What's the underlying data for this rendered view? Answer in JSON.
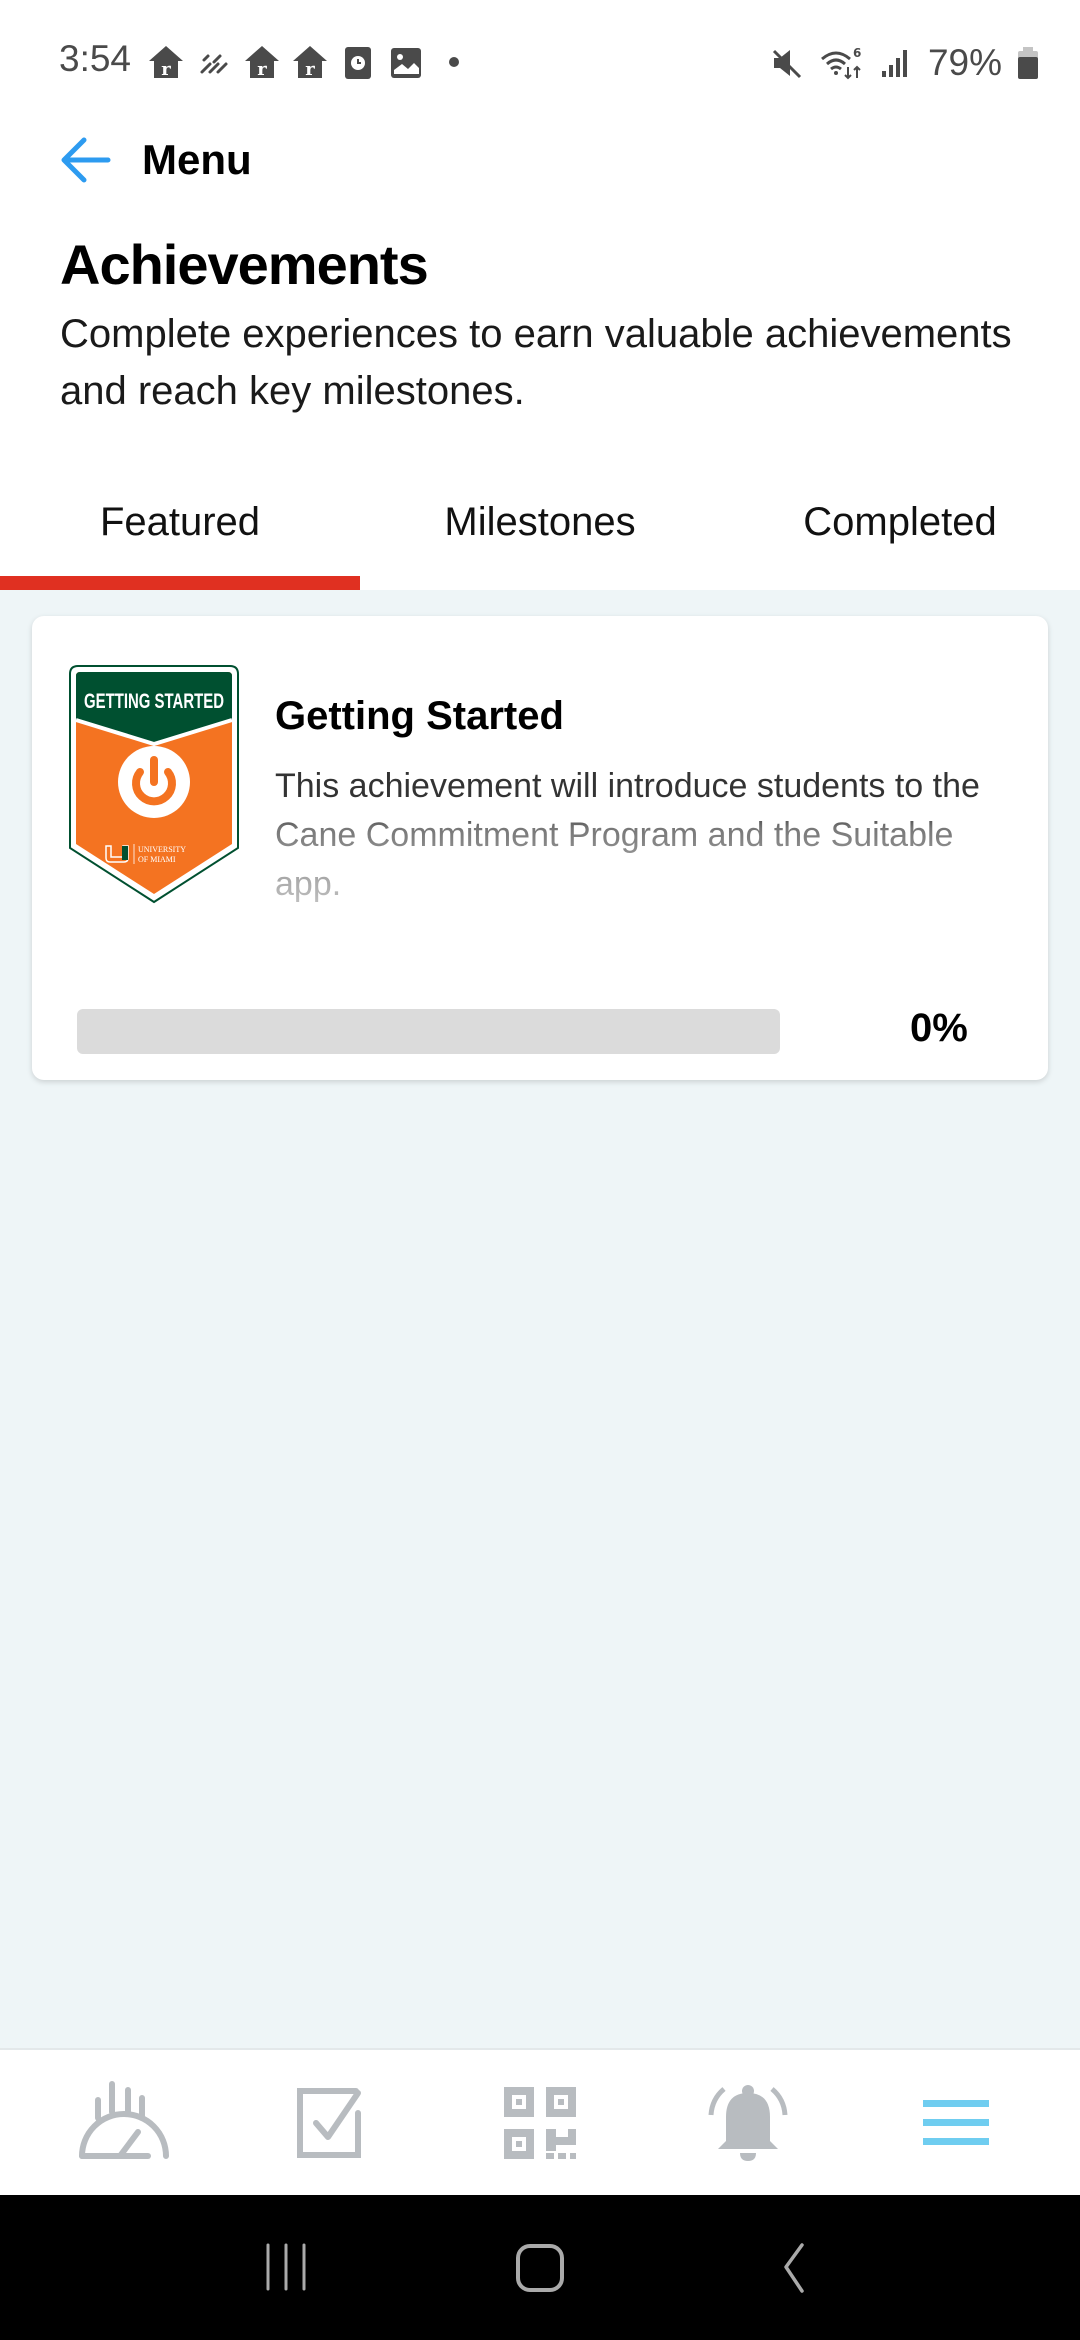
{
  "status_bar": {
    "time": "3:54",
    "battery_percent": "79%",
    "left_icons": [
      "realtor-app-icon",
      "sunlight-icon",
      "realtor-app-icon",
      "realtor-app-icon",
      "clock-app-icon",
      "gallery-icon",
      "dot-icon"
    ],
    "right_icons": [
      "mute-icon",
      "wifi-6-icon",
      "signal-icon",
      "battery-icon"
    ]
  },
  "header": {
    "back_label": "Menu"
  },
  "page": {
    "title": "Achievements",
    "subtitle": "Complete experiences to earn valuable achievements and reach key milestones."
  },
  "tabs": [
    {
      "label": "Featured",
      "active": true
    },
    {
      "label": "Milestones",
      "active": false
    },
    {
      "label": "Completed",
      "active": false
    }
  ],
  "achievements": [
    {
      "title": "Getting Started",
      "description": "This achievement will introduce students to the Cane Commitment Program and the Suitable app.",
      "badge": {
        "banner_text": "GETTING STARTED",
        "org_line1": "UNIVERSITY",
        "org_line2": "OF MIAMI",
        "icon": "power-icon"
      },
      "progress": 0,
      "progress_label": "0%"
    }
  ],
  "bottom_nav": [
    {
      "name": "dashboard",
      "icon": "gauge-icon",
      "active": false
    },
    {
      "name": "tasks",
      "icon": "checkbox-icon",
      "active": false
    },
    {
      "name": "scan",
      "icon": "qr-code-icon",
      "active": false
    },
    {
      "name": "notifications",
      "icon": "bell-icon",
      "active": false
    },
    {
      "name": "menu",
      "icon": "hamburger-menu-icon",
      "active": true
    }
  ],
  "colors": {
    "accent_red": "#e03021",
    "back_arrow_blue": "#2d9bf0",
    "nav_active_blue": "#6fcdf0",
    "nav_inactive_gray": "#b8bcc0",
    "content_bg": "#eef5f7",
    "badge_green": "#005030",
    "badge_orange": "#f47321"
  }
}
